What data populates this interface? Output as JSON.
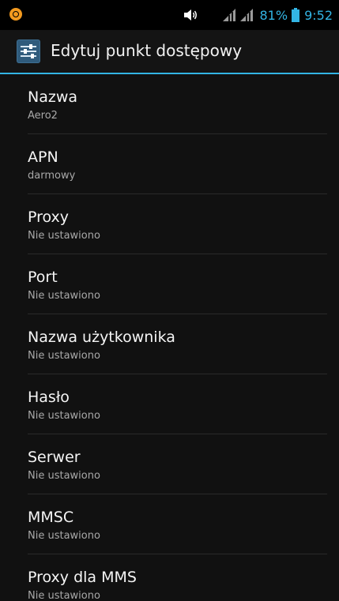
{
  "status_bar": {
    "battery_percent": "81%",
    "time": "9:52",
    "icons": [
      "app-notification-icon",
      "volume-icon",
      "signal-icon",
      "signal-icon",
      "battery-icon"
    ],
    "accent_color": "#33b5e5"
  },
  "action_bar": {
    "icon": "settings-sliders-icon",
    "title": "Edytuj punkt dostępowy"
  },
  "preferences": [
    {
      "title": "Nazwa",
      "summary": "Aero2"
    },
    {
      "title": "APN",
      "summary": "darmowy"
    },
    {
      "title": "Proxy",
      "summary": "Nie ustawiono"
    },
    {
      "title": "Port",
      "summary": "Nie ustawiono"
    },
    {
      "title": "Nazwa użytkownika",
      "summary": "Nie ustawiono"
    },
    {
      "title": "Hasło",
      "summary": "Nie ustawiono"
    },
    {
      "title": "Serwer",
      "summary": "Nie ustawiono"
    },
    {
      "title": "MMSC",
      "summary": "Nie ustawiono"
    },
    {
      "title": "Proxy dla MMS",
      "summary": "Nie ustawiono"
    }
  ]
}
